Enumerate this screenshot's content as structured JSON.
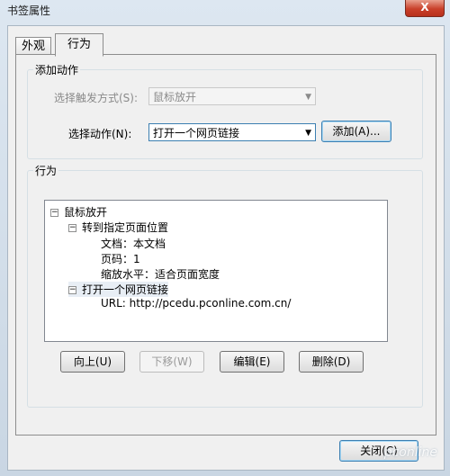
{
  "window": {
    "title": "书签属性",
    "close_glyph": "X"
  },
  "tabs": [
    {
      "label": "外观"
    },
    {
      "label": "行为"
    }
  ],
  "add_action": {
    "legend": "添加动作",
    "trigger_label": "选择触发方式(S):",
    "trigger_value": "鼠标放开",
    "action_label": "选择动作(N):",
    "action_value": "打开一个网页链接",
    "add_button": "添加(A)..."
  },
  "behavior": {
    "legend": "行为",
    "tree": [
      {
        "text": "鼠标放开",
        "expander": "−"
      },
      {
        "text": "转到指定页面位置",
        "expander": "−"
      },
      {
        "text": "文档：本文档"
      },
      {
        "text": "页码：1"
      },
      {
        "text": "缩放水平：适合页面宽度"
      },
      {
        "text": "打开一个网页链接",
        "expander": "−"
      },
      {
        "text": "URL: http://pcedu.pconline.com.cn/"
      }
    ],
    "buttons": {
      "up": "向上(U)",
      "down": "下移(W)",
      "edit": "编辑(E)",
      "delete": "删除(D)"
    }
  },
  "footer": {
    "close_button": "关闭(C)"
  },
  "watermark": "pconline"
}
